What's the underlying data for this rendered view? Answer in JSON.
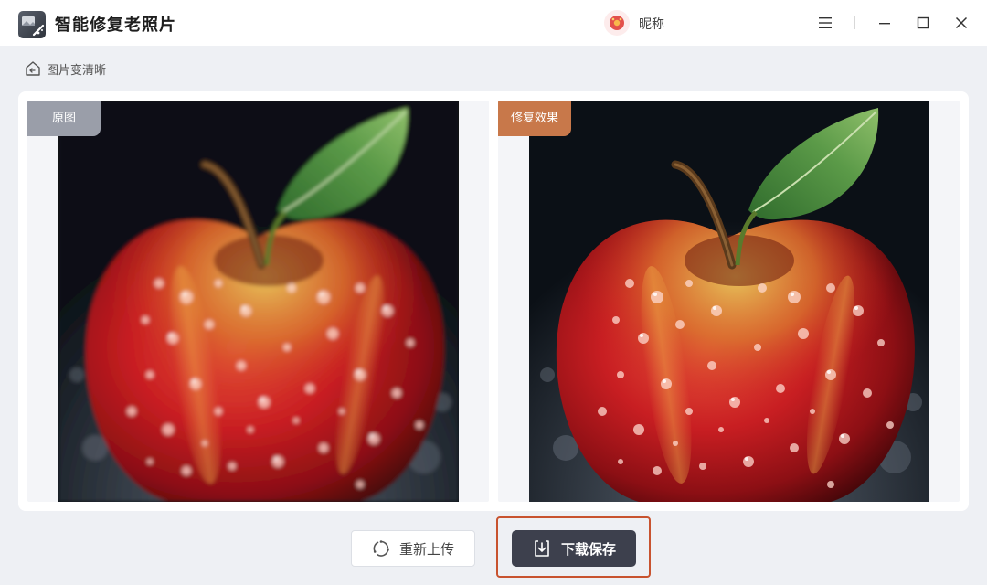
{
  "app": {
    "title": "智能修复老照片"
  },
  "user": {
    "nickname": "昵称"
  },
  "breadcrumb": {
    "label": "图片变清晰"
  },
  "compare": {
    "original_label": "原图",
    "result_label": "修复效果"
  },
  "actions": {
    "reupload_label": "重新上传",
    "download_label": "下载保存"
  },
  "colors": {
    "accent_dark": "#3d404d",
    "result_tag": "#c8784a",
    "original_tag": "#9a9ea9",
    "highlight_outline": "#c8532f"
  },
  "icons": [
    "app-logo-icon",
    "avatar-icon",
    "menu-icon",
    "minimize-icon",
    "maximize-icon",
    "close-icon",
    "home-icon",
    "refresh-icon",
    "download-icon"
  ]
}
